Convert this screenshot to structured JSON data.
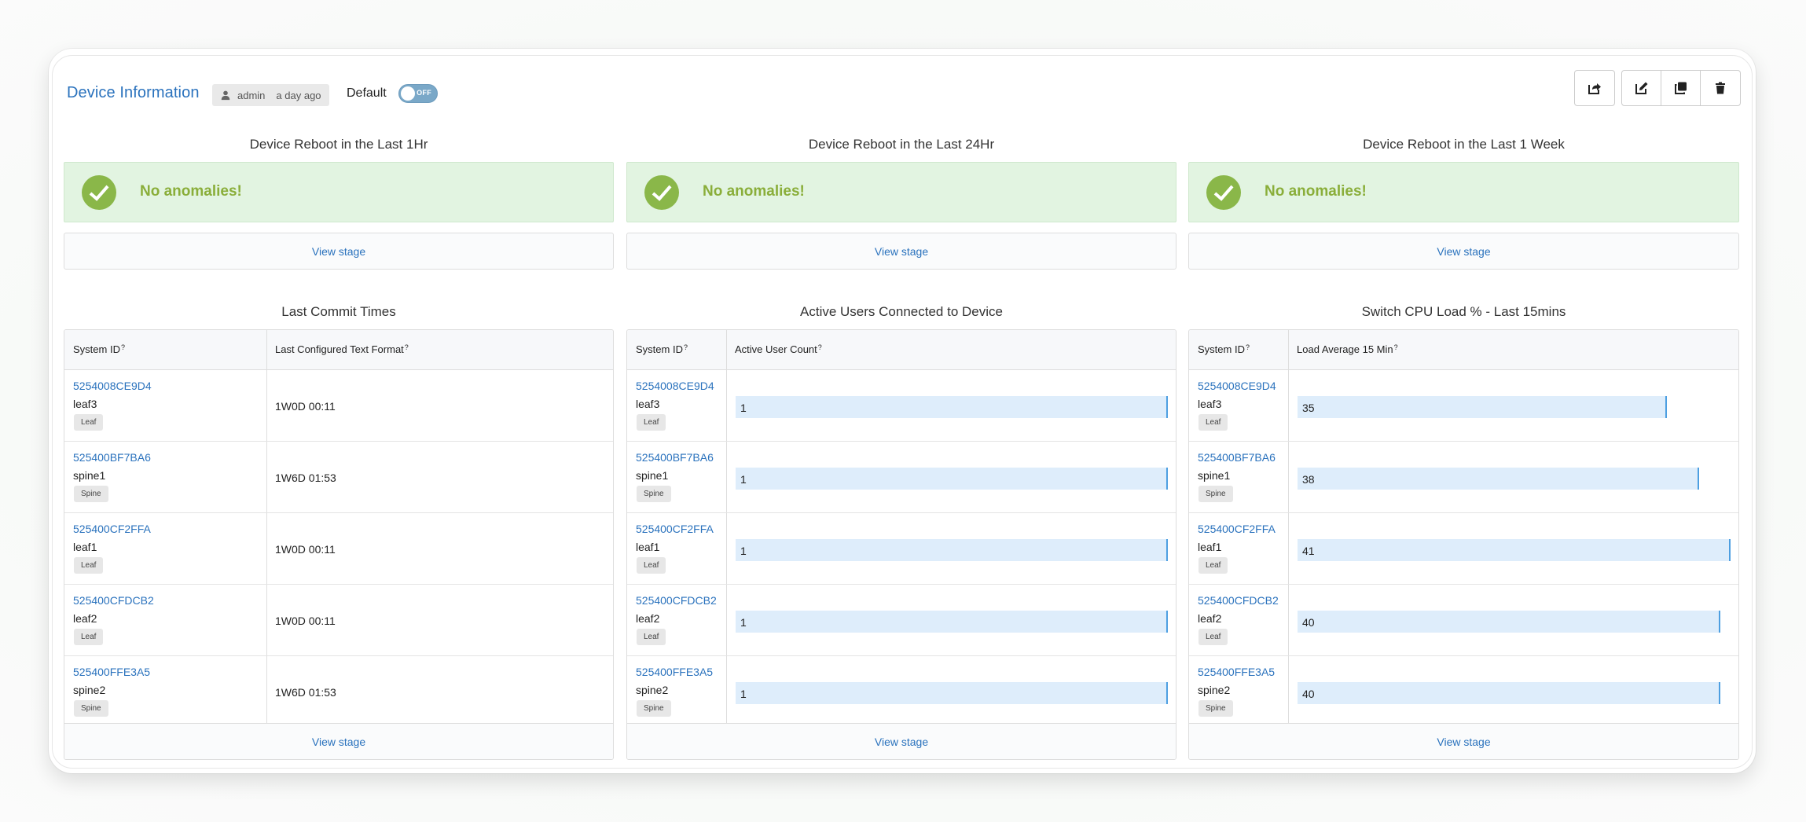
{
  "header": {
    "title": "Device Information",
    "owner": "admin",
    "modified": "a day ago",
    "default_label": "Default",
    "toggle_text": "OFF",
    "tools": [
      "share-icon",
      "edit-icon",
      "clone-icon",
      "trash-icon"
    ]
  },
  "reboot_panels": [
    {
      "title": "Device Reboot in the Last 1Hr",
      "message": "No anomalies!",
      "view_stage": "View stage"
    },
    {
      "title": "Device Reboot in the Last 24Hr",
      "message": "No anomalies!",
      "view_stage": "View stage"
    },
    {
      "title": "Device Reboot in the Last 1 Week",
      "message": "No anomalies!",
      "view_stage": "View stage"
    }
  ],
  "tables": [
    {
      "title": "Last Commit Times",
      "col1": "System ID",
      "col2": "Last Configured Text Format",
      "help": "?",
      "kind": "text",
      "rows": [
        {
          "system_id": "5254008CE9D4",
          "hostname": "leaf3",
          "role": "Leaf",
          "value": "1W0D 00:11"
        },
        {
          "system_id": "525400BF7BA6",
          "hostname": "spine1",
          "role": "Spine",
          "value": "1W6D 01:53"
        },
        {
          "system_id": "525400CF2FFA",
          "hostname": "leaf1",
          "role": "Leaf",
          "value": "1W0D 00:11"
        },
        {
          "system_id": "525400CFDCB2",
          "hostname": "leaf2",
          "role": "Leaf",
          "value": "1W0D 00:11"
        },
        {
          "system_id": "525400FFE3A5",
          "hostname": "spine2",
          "role": "Spine",
          "value": "1W6D 01:53"
        }
      ],
      "view_stage": "View stage"
    },
    {
      "title": "Active Users Connected to Device",
      "col1": "System ID",
      "col2": "Active User Count",
      "help": "?",
      "kind": "bar",
      "max": 1,
      "rows": [
        {
          "system_id": "5254008CE9D4",
          "hostname": "leaf3",
          "role": "Leaf",
          "value": "1"
        },
        {
          "system_id": "525400BF7BA6",
          "hostname": "spine1",
          "role": "Spine",
          "value": "1"
        },
        {
          "system_id": "525400CF2FFA",
          "hostname": "leaf1",
          "role": "Leaf",
          "value": "1"
        },
        {
          "system_id": "525400CFDCB2",
          "hostname": "leaf2",
          "role": "Leaf",
          "value": "1"
        },
        {
          "system_id": "525400FFE3A5",
          "hostname": "spine2",
          "role": "Spine",
          "value": "1"
        }
      ],
      "view_stage": "View stage"
    },
    {
      "title": "Switch CPU Load % - Last 15mins",
      "col1": "System ID",
      "col2": "Load Average 15 Min",
      "help": "?",
      "kind": "bar",
      "max": 41,
      "rows": [
        {
          "system_id": "5254008CE9D4",
          "hostname": "leaf3",
          "role": "Leaf",
          "value": "35"
        },
        {
          "system_id": "525400BF7BA6",
          "hostname": "spine1",
          "role": "Spine",
          "value": "38"
        },
        {
          "system_id": "525400CF2FFA",
          "hostname": "leaf1",
          "role": "Leaf",
          "value": "41"
        },
        {
          "system_id": "525400CFDCB2",
          "hostname": "leaf2",
          "role": "Leaf",
          "value": "40"
        },
        {
          "system_id": "525400FFE3A5",
          "hostname": "spine2",
          "role": "Spine",
          "value": "40"
        }
      ],
      "view_stage": "View stage"
    }
  ],
  "colors": {
    "link": "#2a72bd",
    "success_bg": "#e2f4e1",
    "success_icon": "#8ab749",
    "bar_fill": "#deedfb",
    "bar_edge": "#4d9fe1"
  }
}
